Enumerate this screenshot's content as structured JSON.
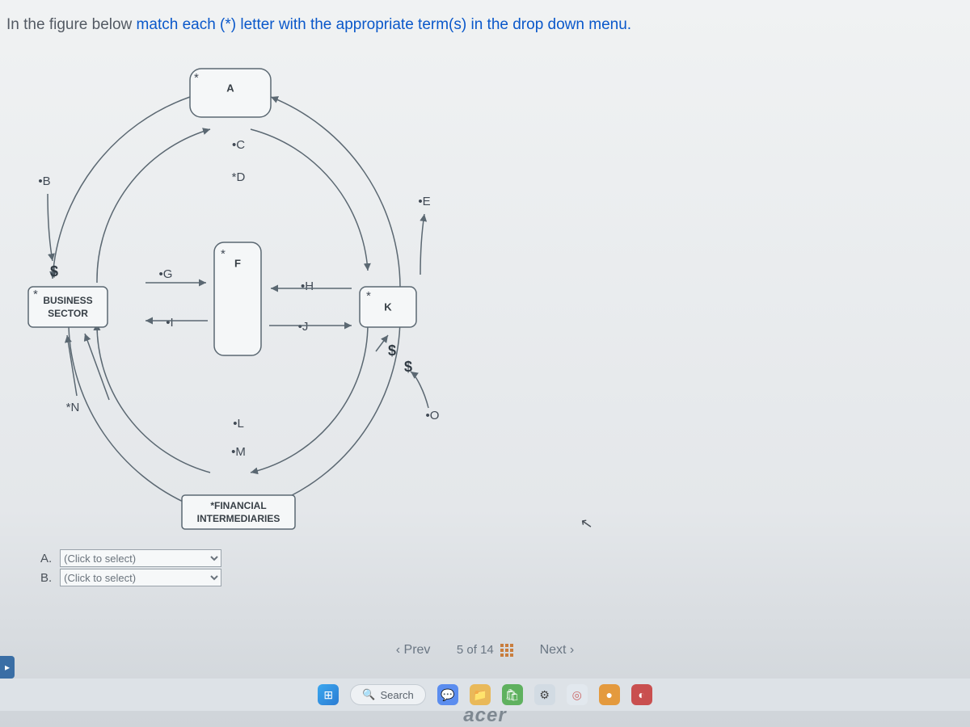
{
  "instruction": {
    "pre": "In the figure below ",
    "link": "match each (*) letter with the appropriate term(s) in the drop down menu.",
    "post": ""
  },
  "diagram": {
    "topBox": "A",
    "bottomBox": "*FINANCIAL\nINTERMEDIARIES",
    "leftBox": "BUSINESS\nSECTOR",
    "centerBox": "F",
    "rightBox": "K",
    "labels": {
      "B": "•B",
      "C": "•C",
      "D": "*D",
      "E": "•E",
      "G": "•G",
      "H": "•H",
      "I": "•I",
      "J": "•J",
      "L": "•L",
      "M": "•M",
      "N": "*N",
      "O": "•O"
    },
    "dollars": [
      "$",
      "$",
      "$"
    ]
  },
  "answers": {
    "rows": [
      {
        "label": "A.",
        "placeholder": "(Click to select)"
      },
      {
        "label": "B.",
        "placeholder": "(Click to select)"
      }
    ]
  },
  "nav": {
    "prev": "Prev",
    "next": "Next",
    "pos": "5",
    "of": "of",
    "total": "14"
  },
  "taskbar": {
    "search_placeholder": "Search",
    "brand": "acer"
  }
}
